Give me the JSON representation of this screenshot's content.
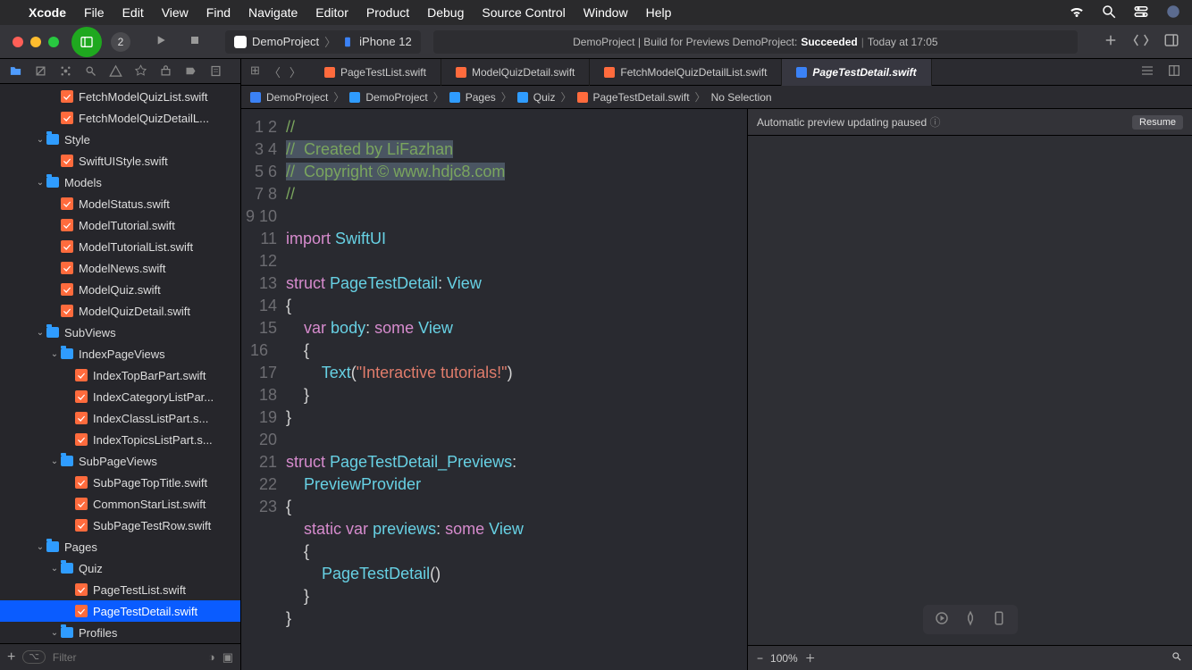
{
  "menubar": {
    "app": "Xcode",
    "items": [
      "File",
      "Edit",
      "View",
      "Find",
      "Navigate",
      "Editor",
      "Product",
      "Debug",
      "Source Control",
      "Window",
      "Help"
    ]
  },
  "toolbar": {
    "badge": "2",
    "scheme_app": "DemoProject",
    "scheme_dest": "iPhone 12",
    "activity_prefix": "DemoProject | Build for Previews DemoProject: ",
    "activity_status": "Succeeded",
    "activity_time": "Today at 17:05"
  },
  "tree": [
    {
      "d": 3,
      "t": "file",
      "name": "FetchModelQuizList.swift"
    },
    {
      "d": 3,
      "t": "file",
      "name": "FetchModelQuizDetailL..."
    },
    {
      "d": 2,
      "t": "folder",
      "name": "Style",
      "open": true
    },
    {
      "d": 3,
      "t": "file",
      "name": "SwiftUIStyle.swift"
    },
    {
      "d": 2,
      "t": "folder",
      "name": "Models",
      "open": true
    },
    {
      "d": 3,
      "t": "file",
      "name": "ModelStatus.swift"
    },
    {
      "d": 3,
      "t": "file",
      "name": "ModelTutorial.swift"
    },
    {
      "d": 3,
      "t": "file",
      "name": "ModelTutorialList.swift"
    },
    {
      "d": 3,
      "t": "file",
      "name": "ModelNews.swift"
    },
    {
      "d": 3,
      "t": "file",
      "name": "ModelQuiz.swift"
    },
    {
      "d": 3,
      "t": "file",
      "name": "ModelQuizDetail.swift"
    },
    {
      "d": 2,
      "t": "folder",
      "name": "SubViews",
      "open": true
    },
    {
      "d": 3,
      "t": "folder",
      "name": "IndexPageViews",
      "open": true
    },
    {
      "d": 4,
      "t": "file",
      "name": "IndexTopBarPart.swift"
    },
    {
      "d": 4,
      "t": "file",
      "name": "IndexCategoryListPar..."
    },
    {
      "d": 4,
      "t": "file",
      "name": "IndexClassListPart.s..."
    },
    {
      "d": 4,
      "t": "file",
      "name": "IndexTopicsListPart.s..."
    },
    {
      "d": 3,
      "t": "folder",
      "name": "SubPageViews",
      "open": true
    },
    {
      "d": 4,
      "t": "file",
      "name": "SubPageTopTitle.swift"
    },
    {
      "d": 4,
      "t": "file",
      "name": "CommonStarList.swift"
    },
    {
      "d": 4,
      "t": "file",
      "name": "SubPageTestRow.swift"
    },
    {
      "d": 2,
      "t": "folder",
      "name": "Pages",
      "open": true
    },
    {
      "d": 3,
      "t": "folder",
      "name": "Quiz",
      "open": true
    },
    {
      "d": 4,
      "t": "file",
      "name": "PageTestList.swift"
    },
    {
      "d": 4,
      "t": "file",
      "name": "PageTestDetail.swift",
      "sel": true
    },
    {
      "d": 3,
      "t": "folder",
      "name": "Profiles",
      "open": true
    }
  ],
  "filter_placeholder": "Filter",
  "tabs": [
    {
      "name": "PageTestList.swift",
      "icon": "swift"
    },
    {
      "name": "ModelQuizDetail.swift",
      "icon": "swift"
    },
    {
      "name": "FetchModelQuizDetailList.swift",
      "icon": "swift"
    },
    {
      "name": "PageTestDetail.swift",
      "icon": "swift",
      "active": true
    }
  ],
  "jump": [
    "DemoProject",
    "DemoProject",
    "Pages",
    "Quiz",
    "PageTestDetail.swift",
    "No Selection"
  ],
  "code_lines": [
    {
      "n": 1,
      "h": "<span class='cmt'>//</span>"
    },
    {
      "n": 2,
      "h": "<span class='cmt hl'>//  Created by LiFazhan</span>"
    },
    {
      "n": 3,
      "h": "<span class='cmt hl'>//  Copyright © www.hdjc8.com</span>"
    },
    {
      "n": 4,
      "h": "<span class='cmt'>//</span>"
    },
    {
      "n": 5,
      "h": ""
    },
    {
      "n": 6,
      "h": "<span class='kw'>import</span> <span class='typ'>SwiftUI</span>"
    },
    {
      "n": 7,
      "h": ""
    },
    {
      "n": 8,
      "h": "<span class='kw'>struct</span> <span class='typ'>PageTestDetail</span>: <span class='typ'>View</span>"
    },
    {
      "n": 9,
      "h": "{"
    },
    {
      "n": 10,
      "h": "    <span class='kw'>var</span> <span class='fn'>body</span>: <span class='kw'>some</span> <span class='typ'>View</span>"
    },
    {
      "n": 11,
      "h": "    {"
    },
    {
      "n": 12,
      "h": "        <span class='typ'>Text</span>(<span class='str'>\"Interactive tutorials!\"</span>)"
    },
    {
      "n": 13,
      "h": "    }"
    },
    {
      "n": 14,
      "h": "}"
    },
    {
      "n": 15,
      "h": ""
    },
    {
      "n": 16,
      "h": "<span class='kw'>struct</span> <span class='typ'>PageTestDetail_Previews</span>:"
    },
    {
      "n": "",
      "h": "    <span class='typ'>PreviewProvider</span>"
    },
    {
      "n": 17,
      "h": "{"
    },
    {
      "n": 18,
      "h": "    <span class='kw'>static</span> <span class='kw'>var</span> <span class='fn'>previews</span>: <span class='kw'>some</span> <span class='typ'>View</span>"
    },
    {
      "n": 19,
      "h": "    {"
    },
    {
      "n": 20,
      "h": "        <span class='typ'>PageTestDetail</span>()"
    },
    {
      "n": 21,
      "h": "    }"
    },
    {
      "n": 22,
      "h": "}"
    },
    {
      "n": 23,
      "h": ""
    }
  ],
  "preview": {
    "status": "Automatic preview updating paused",
    "resume": "Resume",
    "zoom": "100%"
  }
}
